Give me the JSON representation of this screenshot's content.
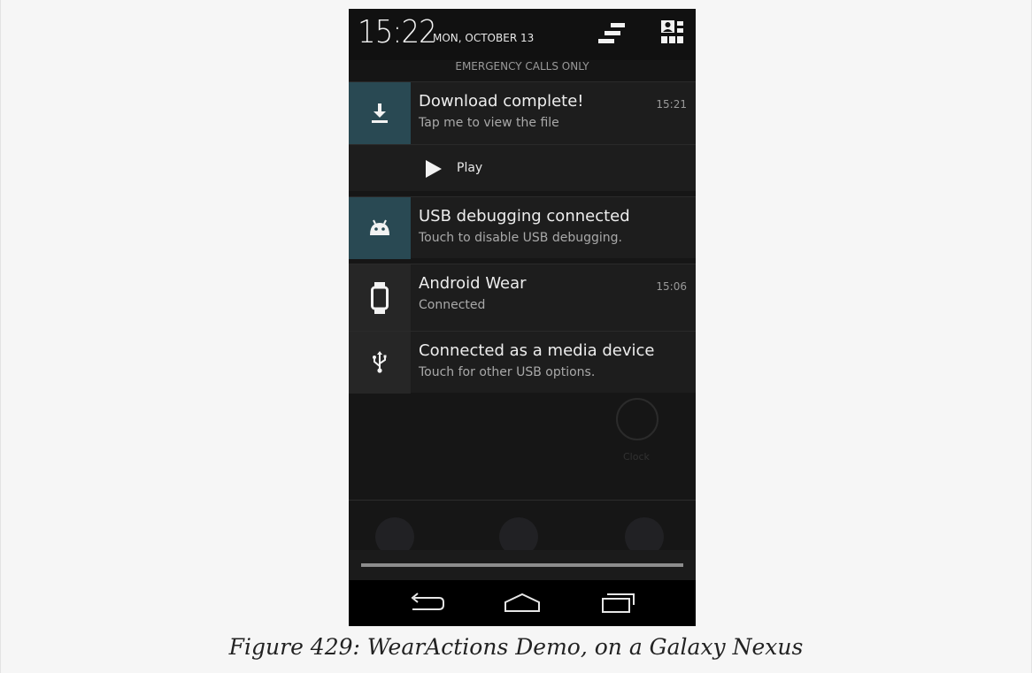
{
  "status_bar": {
    "time": "15:22",
    "date": "MON, OCTOBER 13",
    "emergency": "EMERGENCY CALLS ONLY",
    "icons": [
      "clear-all-notifications-icon",
      "quick-settings-icon"
    ]
  },
  "notifications": [
    {
      "icon": "download-icon",
      "title": "Download complete!",
      "subtitle": "Tap me to view the file",
      "time": "15:21",
      "action": {
        "icon": "play-icon",
        "label": "Play"
      }
    },
    {
      "icon": "android-icon",
      "title": "USB debugging connected",
      "subtitle": "Touch to disable USB debugging.",
      "time": ""
    },
    {
      "icon": "watch-icon",
      "title": "Android Wear",
      "subtitle": "Connected",
      "time": "15:06"
    },
    {
      "icon": "usb-icon",
      "title": "Connected as a media device",
      "subtitle": "Touch for other USB options.",
      "time": ""
    }
  ],
  "background_launcher": {
    "clock_label": "Clock"
  },
  "navigation": {
    "buttons": [
      "back-icon",
      "home-icon",
      "recents-icon"
    ]
  },
  "caption": "Figure 429: WearActions Demo, on a Galaxy Nexus",
  "colors": {
    "panel": "#1d1d1d",
    "accent_icon_bg": "#294953",
    "page_bg": "#f6f6f6"
  }
}
